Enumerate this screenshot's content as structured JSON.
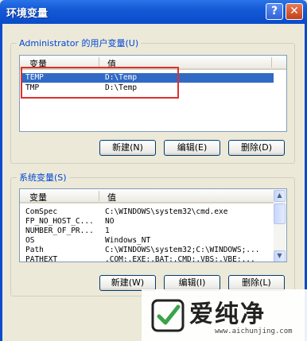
{
  "window": {
    "title": "环境变量",
    "help_glyph": "?",
    "close_glyph": "✕"
  },
  "user_vars": {
    "group_label": "Administrator 的用户变量(U)",
    "headers": [
      "变量",
      "值"
    ],
    "rows": [
      {
        "name": "TEMP",
        "value": "D:\\Temp",
        "selected": true
      },
      {
        "name": "TMP",
        "value": "D:\\Temp",
        "selected": false
      }
    ],
    "buttons": {
      "new": "新建(N)",
      "edit": "编辑(E)",
      "delete": "删除(D)"
    }
  },
  "system_vars": {
    "group_label": "系统变量(S)",
    "headers": [
      "变量",
      "值"
    ],
    "rows": [
      {
        "name": "ComSpec",
        "value": "C:\\WINDOWS\\system32\\cmd.exe"
      },
      {
        "name": "FP_NO_HOST_C...",
        "value": "NO"
      },
      {
        "name": "NUMBER_OF_PR...",
        "value": "1"
      },
      {
        "name": "OS",
        "value": "Windows_NT"
      },
      {
        "name": "Path",
        "value": "C:\\WINDOWS\\system32;C:\\WINDOWS;..."
      },
      {
        "name": "PATHEXT",
        "value": ".COM;.EXE;.BAT;.CMD;.VBS;.VBE;..."
      }
    ],
    "buttons": {
      "new": "新建(W)",
      "edit": "编辑(I)",
      "delete": "删除(L)"
    }
  },
  "watermark": {
    "text": "爱纯净",
    "url": "www.aichunjing.com"
  },
  "colors": {
    "title_bar": "#0a4ccb",
    "selection": "#316ac5",
    "highlight_box": "#e0302c",
    "dialog_bg": "#ece9d8"
  }
}
